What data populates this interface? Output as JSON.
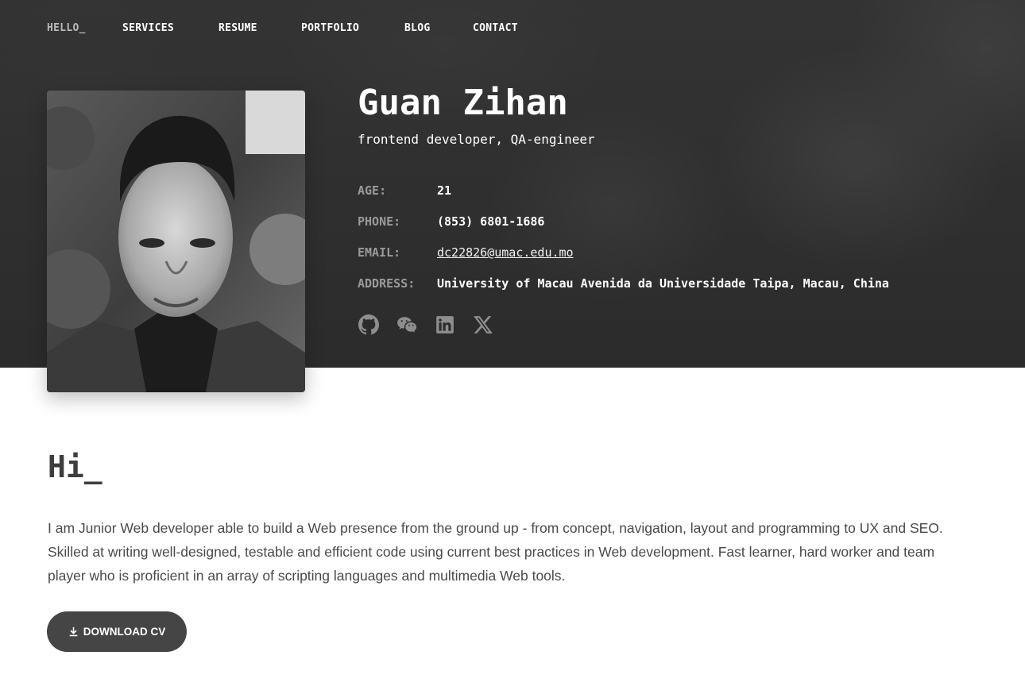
{
  "nav": {
    "items": [
      {
        "label": "HELLO_",
        "active": true
      },
      {
        "label": "SERVICES"
      },
      {
        "label": "RESUME"
      },
      {
        "label": "PORTFOLIO"
      },
      {
        "label": "BLOG"
      },
      {
        "label": "CONTACT"
      }
    ]
  },
  "profile": {
    "name": "Guan Zihan",
    "role": "frontend developer, QA-engineer",
    "fields": [
      {
        "label": "AGE:",
        "value": "21"
      },
      {
        "label": "PHONE:",
        "value": "(853) 6801-1686"
      },
      {
        "label": "EMAIL:",
        "value": "dc22826@umac.edu.mo"
      },
      {
        "label": "ADDRESS:",
        "value": "University of Macau Avenida da Universidade Taipa, Macau, China"
      }
    ],
    "social": [
      "github-icon",
      "wechat-icon",
      "linkedin-icon",
      "x-twitter-icon"
    ]
  },
  "intro": {
    "heading": "Hi_",
    "bio": "I am Junior Web developer able to build a Web presence from the ground up - from concept, navigation, layout and programming to UX and SEO. Skilled at writing well-designed, testable and efficient code using current best practices in Web development. Fast learner, hard worker and team player who is proficient in an array of scripting languages and multimedia Web tools.",
    "button_label": "DOWNLOAD CV"
  },
  "colors": {
    "hero_bg": "#333333",
    "button_bg": "#454545",
    "label_gray": "#9a9a9a",
    "icon_gray": "#8e8e8e"
  }
}
